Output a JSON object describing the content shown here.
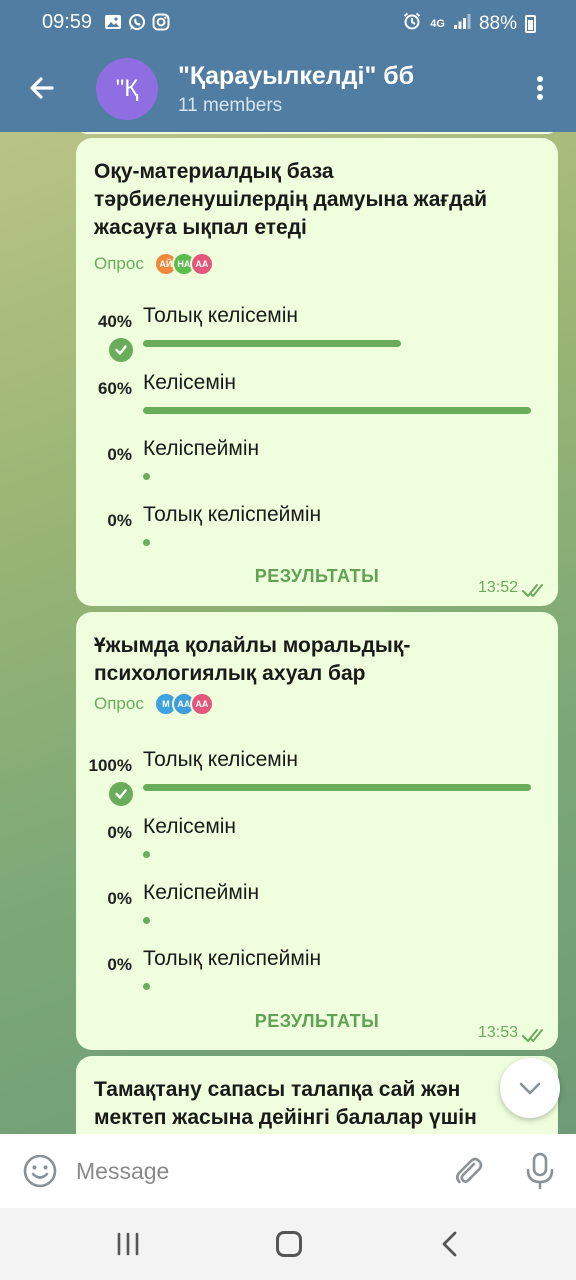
{
  "status_bar": {
    "time": "09:59",
    "network": "4G",
    "battery": "88%",
    "notification_icons": [
      "gallery-icon",
      "whatsapp-icon",
      "instagram-icon"
    ]
  },
  "header": {
    "avatar_letter": "\"Қ",
    "title": "\"Қарауылкелді\" бб",
    "subtitle": "11 members"
  },
  "polls": [
    {
      "question": "Оқу-материалдық база тәрбиеленушілердің дамуына жағдай жасауға ықпал етеді",
      "type_label": "Опрос",
      "voters": [
        {
          "initials": "АЙ",
          "color": "#f0883a"
        },
        {
          "initials": "НА",
          "color": "#5cbd4e"
        },
        {
          "initials": "АА",
          "color": "#e5567b"
        }
      ],
      "options": [
        {
          "pct": "40%",
          "label": "Толық келісемін",
          "fraction": 0.4,
          "chosen": true
        },
        {
          "pct": "60%",
          "label": "Келісемін",
          "fraction": 0.6,
          "chosen": false
        },
        {
          "pct": "0%",
          "label": "Келіспеймін",
          "fraction": 0,
          "chosen": false
        },
        {
          "pct": "0%",
          "label": "Толық келіспеймін",
          "fraction": 0,
          "chosen": false
        }
      ],
      "results_label": "РЕЗУЛЬТАТЫ",
      "time": "13:52"
    },
    {
      "question": "Ұжымда қолайлы моральдық-психологиялық ахуал бар",
      "type_label": "Опрос",
      "voters": [
        {
          "initials": "М",
          "color": "#3ea3e0"
        },
        {
          "initials": "АА",
          "color": "#3d9fd9"
        },
        {
          "initials": "АА",
          "color": "#e5567b"
        }
      ],
      "options": [
        {
          "pct": "100%",
          "label": "Толық келісемін",
          "fraction": 1.0,
          "chosen": true
        },
        {
          "pct": "0%",
          "label": "Келісемін",
          "fraction": 0,
          "chosen": false
        },
        {
          "pct": "0%",
          "label": "Келіспеймін",
          "fraction": 0,
          "chosen": false
        },
        {
          "pct": "0%",
          "label": "Толық келіспеймін",
          "fraction": 0,
          "chosen": false
        }
      ],
      "results_label": "РЕЗУЛЬТАТЫ",
      "time": "13:53"
    },
    {
      "question": "Тамақтану сапасы талапқа сай жән мектеп жасына дейінгі балалар үшін"
    }
  ],
  "composer": {
    "placeholder": "Message"
  },
  "colors": {
    "header": "#517da2",
    "bubble": "#effedd",
    "accent": "#69ad5b"
  }
}
